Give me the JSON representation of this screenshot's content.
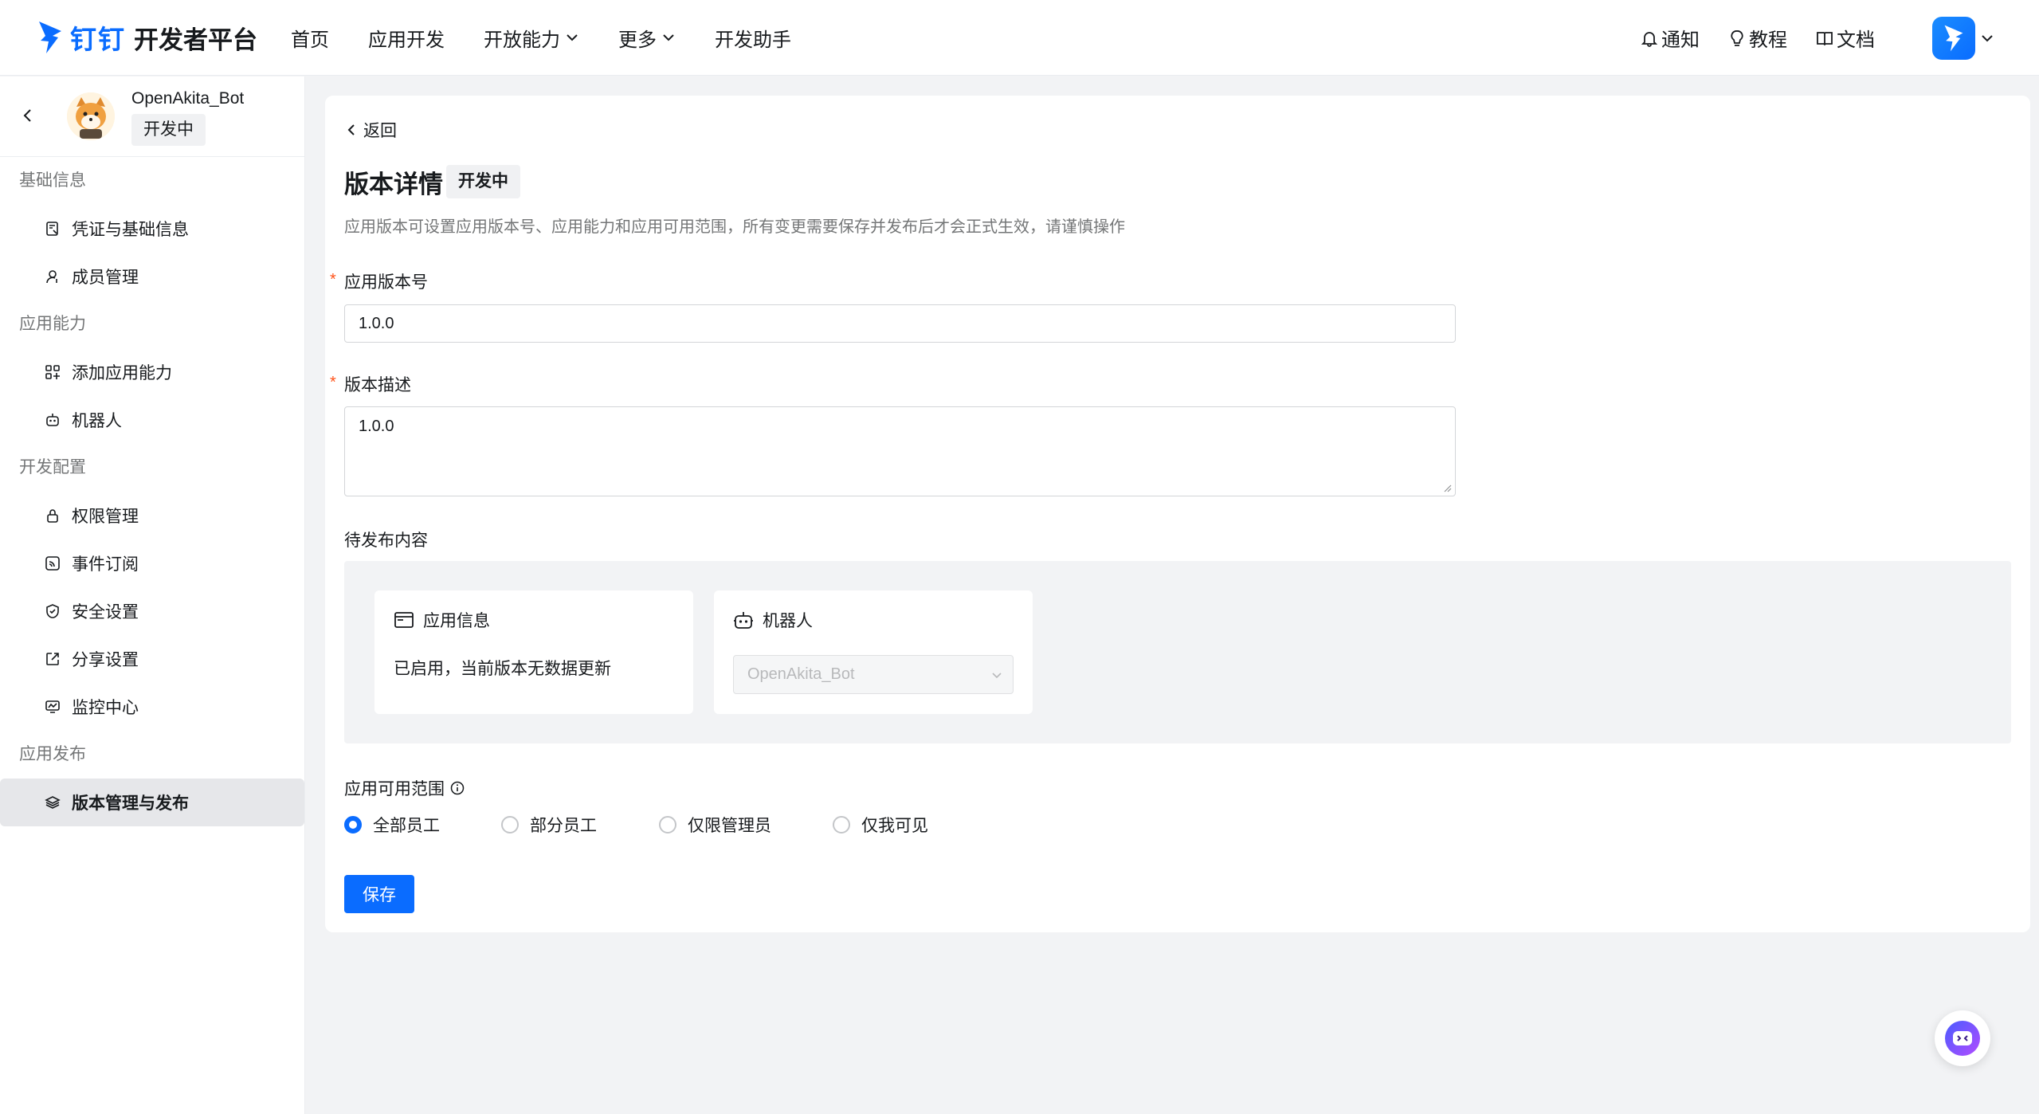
{
  "header": {
    "brand": "钉钉",
    "title": "开发者平台",
    "nav": [
      {
        "label": "首页",
        "has_dropdown": false
      },
      {
        "label": "应用开发",
        "has_dropdown": false
      },
      {
        "label": "开放能力",
        "has_dropdown": true
      },
      {
        "label": "更多",
        "has_dropdown": true
      },
      {
        "label": "开发助手",
        "has_dropdown": false
      }
    ],
    "right_links": [
      {
        "label": "通知",
        "icon": "bell-icon"
      },
      {
        "label": "教程",
        "icon": "lightbulb-icon"
      },
      {
        "label": "文档",
        "icon": "book-icon"
      }
    ]
  },
  "sidebar": {
    "app_name": "OpenAkita_Bot",
    "app_status": "开发中",
    "groups": [
      {
        "title": "基础信息",
        "items": [
          {
            "label": "凭证与基础信息",
            "icon": "credential-icon",
            "active": false
          },
          {
            "label": "成员管理",
            "icon": "user-icon",
            "active": false
          }
        ]
      },
      {
        "title": "应用能力",
        "items": [
          {
            "label": "添加应用能力",
            "icon": "grid-add-icon",
            "active": false
          },
          {
            "label": "机器人",
            "icon": "robot-icon",
            "active": false
          }
        ]
      },
      {
        "title": "开发配置",
        "items": [
          {
            "label": "权限管理",
            "icon": "lock-icon",
            "active": false
          },
          {
            "label": "事件订阅",
            "icon": "rss-icon",
            "active": false
          },
          {
            "label": "安全设置",
            "icon": "shield-icon",
            "active": false
          },
          {
            "label": "分享设置",
            "icon": "share-icon",
            "active": false
          },
          {
            "label": "监控中心",
            "icon": "monitor-icon",
            "active": false
          }
        ]
      },
      {
        "title": "应用发布",
        "items": [
          {
            "label": "版本管理与发布",
            "icon": "layers-icon",
            "active": true
          }
        ]
      }
    ]
  },
  "main": {
    "back_label": "返回",
    "title": "版本详情",
    "title_badge": "开发中",
    "description": "应用版本可设置应用版本号、应用能力和应用可用范围，所有变更需要保存并发布后才会正式生效，请谨慎操作",
    "version_label": "应用版本号",
    "version_value": "1.0.0",
    "desc_label": "版本描述",
    "desc_value": "1.0.0",
    "pending_label": "待发布内容",
    "app_info_card": {
      "title": "应用信息",
      "text": "已启用，当前版本无数据更新"
    },
    "robot_card": {
      "title": "机器人",
      "select_value": "OpenAkita_Bot"
    },
    "scope_label": "应用可用范围",
    "scope_options": [
      {
        "label": "全部员工",
        "selected": true
      },
      {
        "label": "部分员工",
        "selected": false
      },
      {
        "label": "仅限管理员",
        "selected": false
      },
      {
        "label": "仅我可见",
        "selected": false
      }
    ],
    "save_label": "保存"
  },
  "colors": {
    "accent": "#0a6cff",
    "required": "#ff5219",
    "muted_text": "#747677",
    "page_bg": "#f2f3f5"
  }
}
